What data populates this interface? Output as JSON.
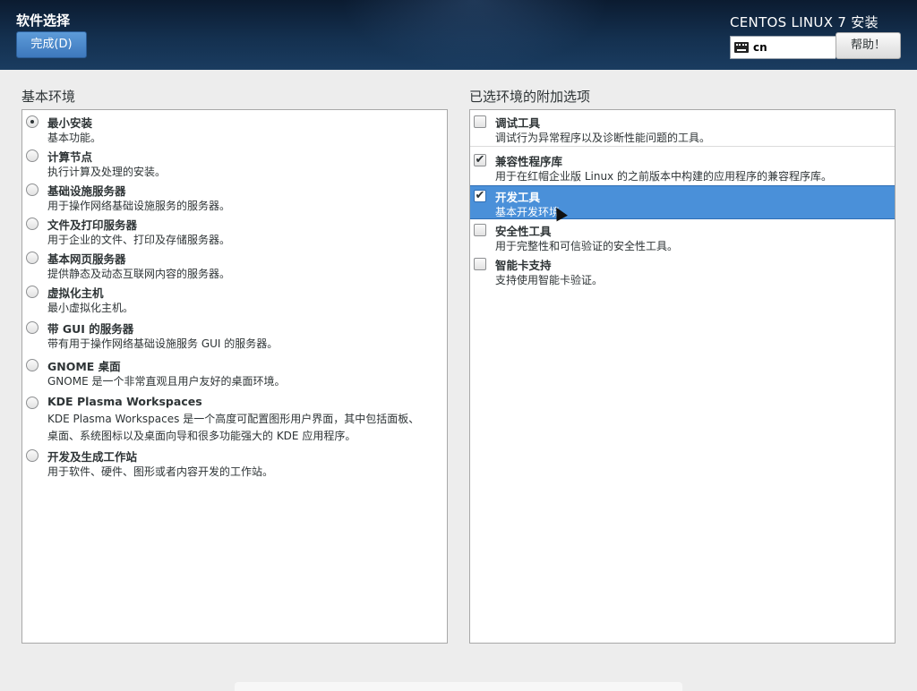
{
  "header": {
    "page_title": "软件选择",
    "done_label": "完成(D)",
    "product_title": "CENTOS LINUX 7 安装",
    "keyboard_layout": "cn",
    "help_label": "帮助！"
  },
  "base_env": {
    "label": "基本环境",
    "selected_index": 0,
    "items": [
      {
        "title": "最小安装",
        "desc": "基本功能。"
      },
      {
        "title": "计算节点",
        "desc": "执行计算及处理的安装。"
      },
      {
        "title": "基础设施服务器",
        "desc": "用于操作网络基础设施服务的服务器。"
      },
      {
        "title": "文件及打印服务器",
        "desc": "用于企业的文件、打印及存储服务器。"
      },
      {
        "title": "基本网页服务器",
        "desc": "提供静态及动态互联网内容的服务器。"
      },
      {
        "title": "虚拟化主机",
        "desc": "最小虚拟化主机。"
      },
      {
        "title": "带 GUI 的服务器",
        "desc": "带有用于操作网络基础设施服务 GUI 的服务器。"
      },
      {
        "title": "GNOME 桌面",
        "desc": "GNOME 是一个非常直观且用户友好的桌面环境。"
      },
      {
        "title": "KDE Plasma Workspaces",
        "desc": "KDE Plasma Workspaces 是一个高度可配置图形用户界面，其中包括面板、",
        "desc2": "桌面、系统图标以及桌面向导和很多功能强大的 KDE 应用程序。"
      },
      {
        "title": "开发及生成工作站",
        "desc": "用于软件、硬件、图形或者内容开发的工作站。"
      }
    ]
  },
  "addons": {
    "label": "已选环境的附加选项",
    "items": [
      {
        "title": "调试工具",
        "desc": "调试行为异常程序以及诊断性能问题的工具。",
        "checked": false
      },
      {
        "title": "兼容性程序库",
        "desc": "用于在红帽企业版 Linux 的之前版本中构建的应用程序的兼容程序库。",
        "checked": true
      },
      {
        "title": "开发工具",
        "desc": "基本开发环境。",
        "checked": true,
        "selected": true
      },
      {
        "title": "安全性工具",
        "desc": "用于完整性和可信验证的安全性工具。",
        "checked": false
      },
      {
        "title": "智能卡支持",
        "desc": "支持使用智能卡验证。",
        "checked": false
      }
    ]
  },
  "colors": {
    "header_bg": "#14304f",
    "accent": "#4a90d9",
    "panel_bg": "#ffffff",
    "page_bg": "#ededed"
  }
}
